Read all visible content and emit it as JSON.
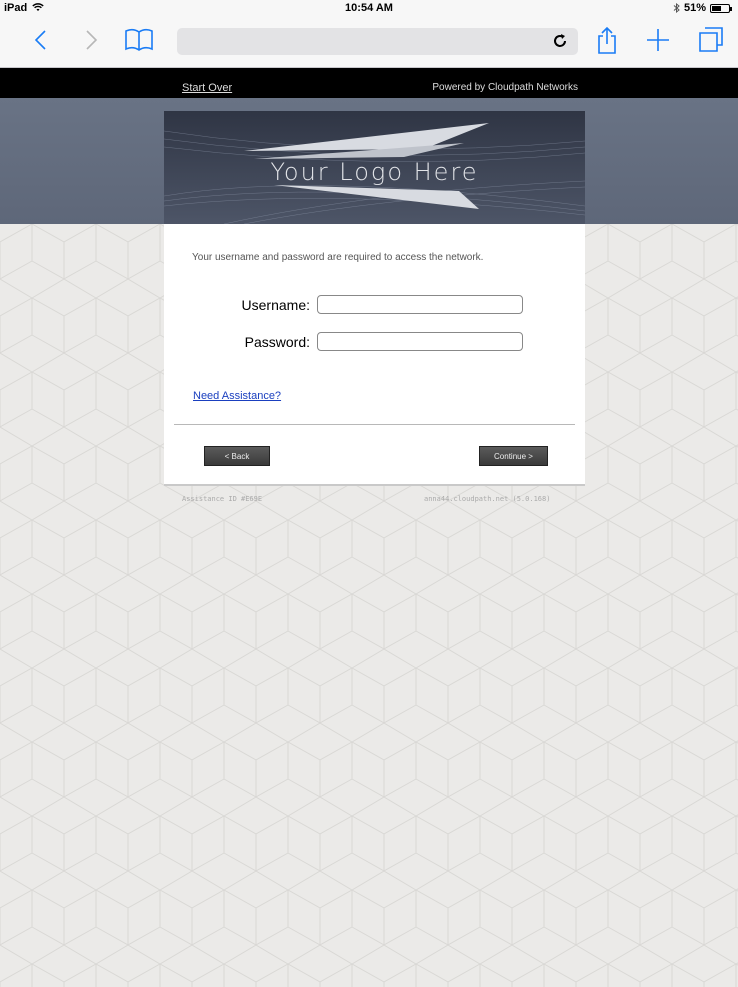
{
  "status_bar": {
    "device": "iPad",
    "time": "10:54 AM",
    "battery": "51%"
  },
  "toolbar": {
    "back_icon": "chevron-left-icon",
    "forward_icon": "chevron-right-icon",
    "bookmarks_icon": "book-icon",
    "reload_icon": "reload-icon",
    "share_icon": "share-icon",
    "add_icon": "plus-icon",
    "tabs_icon": "tabs-icon"
  },
  "header": {
    "start_over": "Start Over",
    "powered_by": "Powered by Cloudpath Networks"
  },
  "logo": {
    "text": "Your Logo Here"
  },
  "form": {
    "intro": "Your username and password are required to access the network.",
    "username_label": "Username:",
    "password_label": "Password:",
    "username_value": "",
    "password_value": "",
    "help_link": "Need Assistance?",
    "back_button": "< Back",
    "continue_button": "Continue >"
  },
  "footer": {
    "assistance_id": "Assistance ID #E69E",
    "server": "anna44.cloudpath.net (5.0.168)"
  },
  "colors": {
    "accent": "#1a7cf5",
    "header_bg": "#000000",
    "band_bg": "#697385",
    "page_bg": "#ebeae8",
    "link": "#1a3fbf"
  }
}
